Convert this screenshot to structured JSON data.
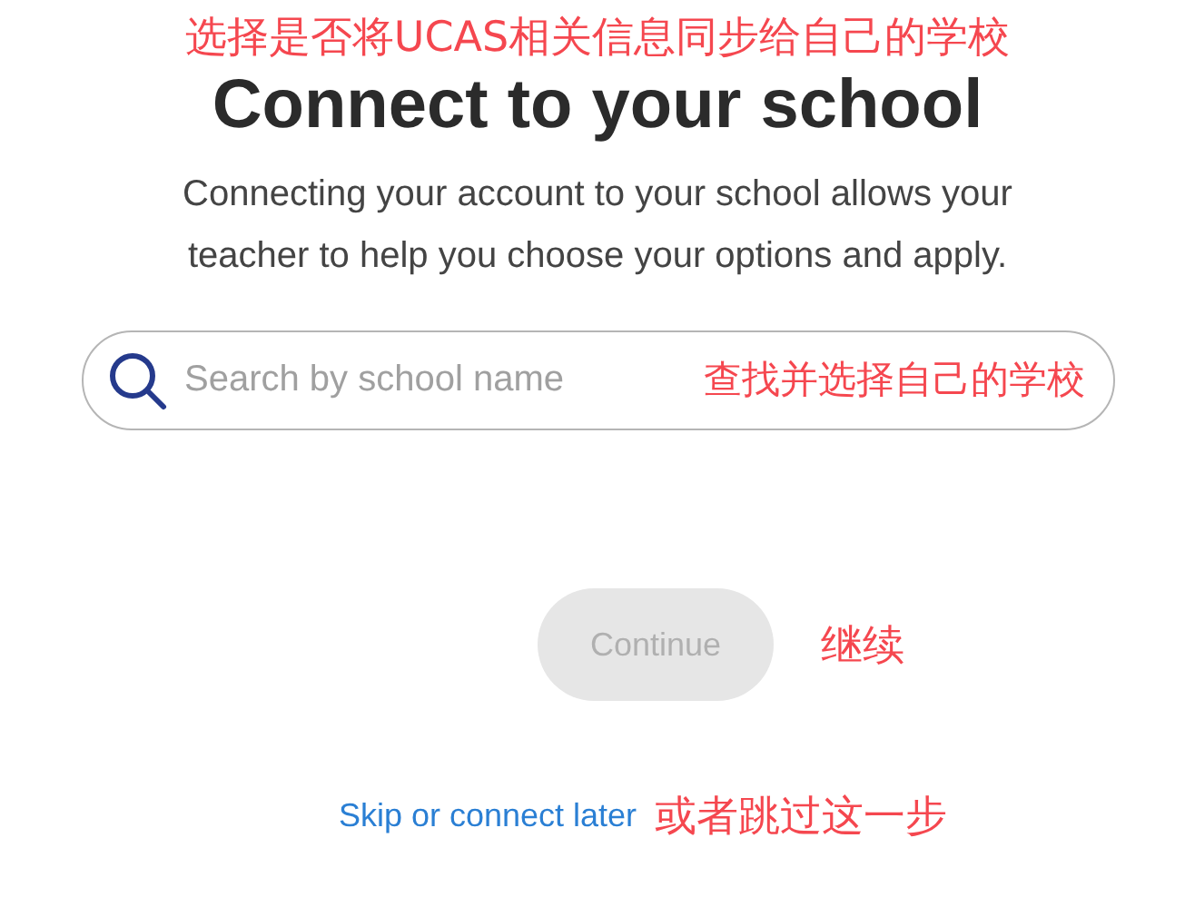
{
  "heading_annotation": "选择是否将UCAS相关信息同步给自己的学校",
  "title": "Connect to your school",
  "description": "Connecting your account to your school allows your teacher to help you choose your options and apply.",
  "search": {
    "placeholder": "Search by school name",
    "annotation": "查找并选择自己的学校"
  },
  "continue_button": {
    "label": "Continue",
    "disabled": true,
    "annotation": "继续"
  },
  "skip_link": {
    "label": "Skip or connect later",
    "annotation": "或者跳过这一步"
  }
}
